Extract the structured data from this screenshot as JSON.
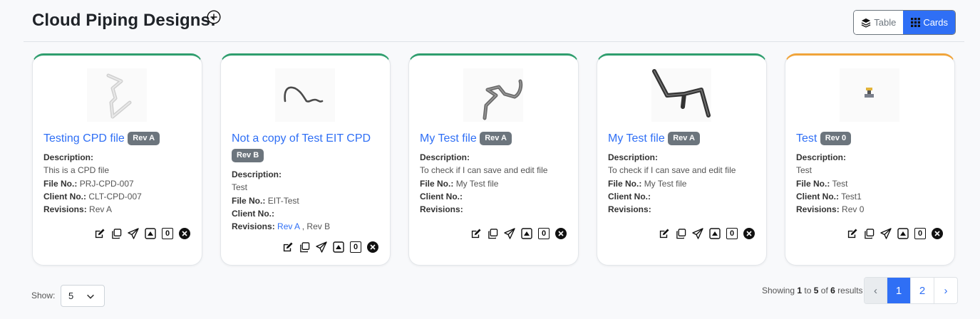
{
  "page": {
    "title": "Cloud Piping Designs:"
  },
  "view_toggle": {
    "table_label": "Table",
    "cards_label": "Cards",
    "active": "Cards"
  },
  "labels": {
    "description": "Description:",
    "file_no": "File No.:",
    "client_no": "Client No.:",
    "revisions": "Revisions:"
  },
  "cards": [
    {
      "title": "Testing CPD file",
      "badge": "Rev A",
      "description": "This is a CPD file",
      "file_no": "PRJ-CPD-007",
      "client_no": "CLT-CPD-007",
      "revisions": "Rev A",
      "count": "0",
      "status_color": "#2f9e6e"
    },
    {
      "title": "Not a copy of Test EIT CPD",
      "badge": "Rev B",
      "description": "Test",
      "file_no": "EIT-Test",
      "client_no": "",
      "revisions_link": "Rev A",
      "revisions_sep": " , ",
      "revisions_rest": "Rev B",
      "count": "0",
      "status_color": "#2f9e6e"
    },
    {
      "title": "My Test file",
      "badge": "Rev A",
      "description": "To check if I can save and edit file",
      "file_no": "My Test file",
      "client_no": "",
      "revisions": "",
      "count": "0",
      "status_color": "#2f9e6e"
    },
    {
      "title": "My Test file",
      "badge": "Rev A",
      "description": "To check if I can save and edit file",
      "file_no": "My Test file",
      "client_no": "",
      "revisions": "",
      "count": "0",
      "status_color": "#2f9e6e"
    },
    {
      "title": "Test",
      "badge": "Rev 0",
      "description": "Test",
      "file_no": "Test",
      "client_no": "Test1",
      "revisions": "Rev 0",
      "count": "0",
      "status_color": "#f0a43a"
    }
  ],
  "footer": {
    "show_label": "Show:",
    "page_size": "5",
    "results_prefix": "Showing",
    "results_from": "1",
    "results_to_word": "to",
    "results_to": "5",
    "results_of_word": "of",
    "results_total": "6",
    "results_suffix": "results",
    "pagination": {
      "prev": "‹",
      "pages": [
        "1",
        "2"
      ],
      "next": "›",
      "current": "1"
    }
  }
}
